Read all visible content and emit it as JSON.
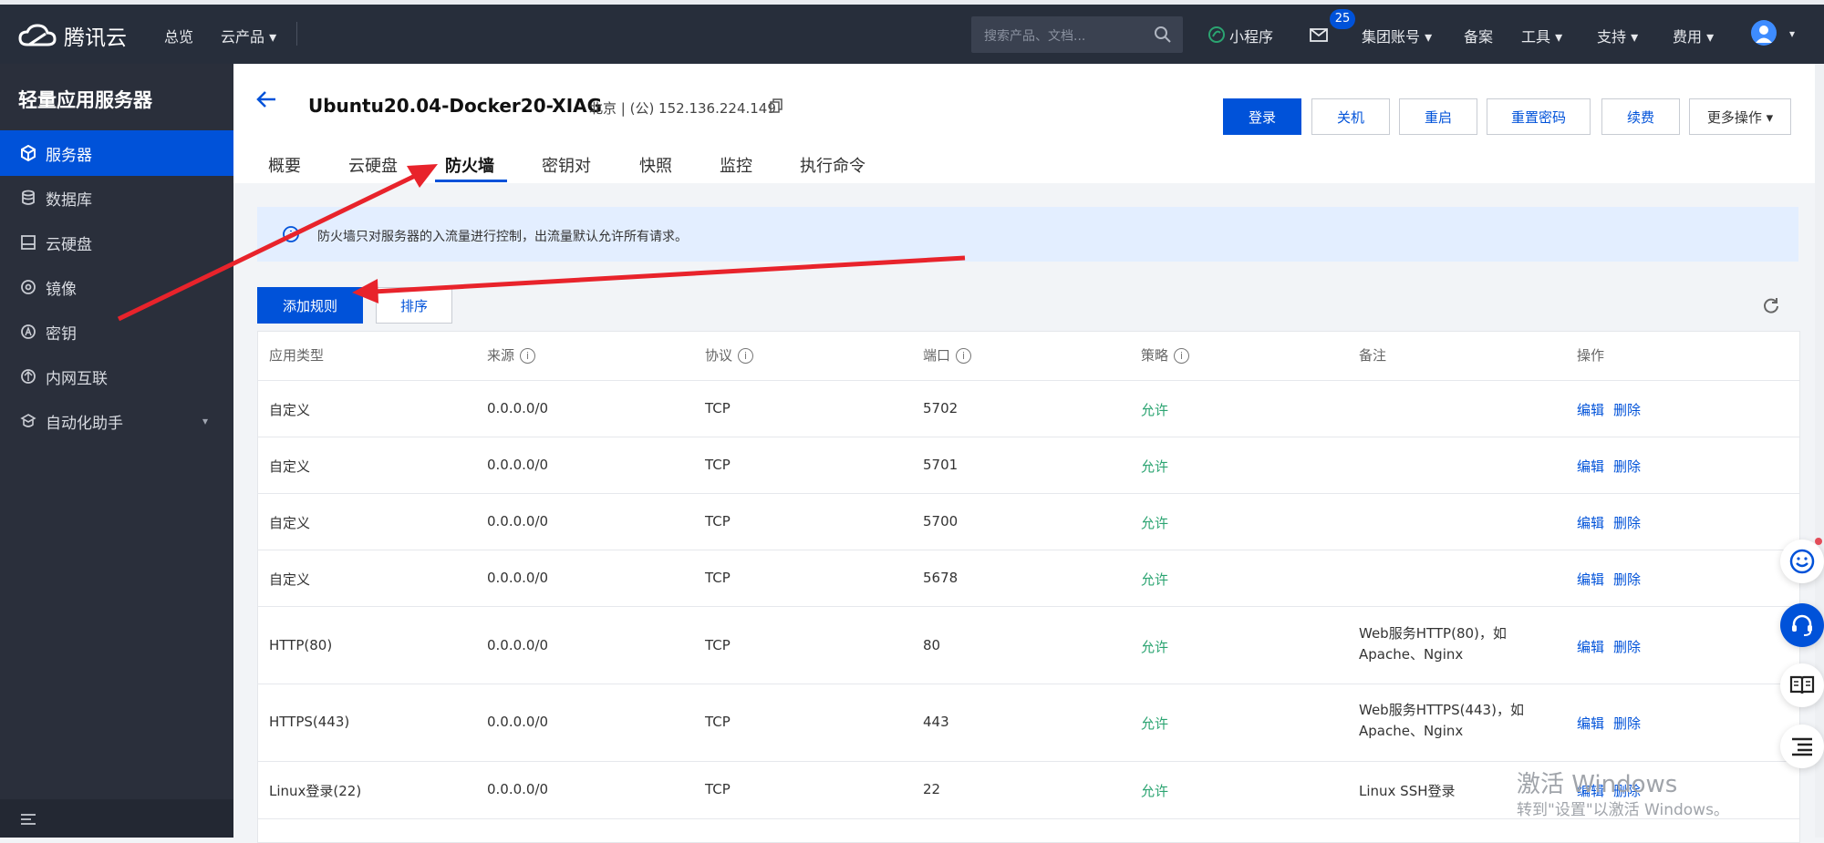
{
  "topbar": {
    "brand": "腾讯云",
    "nav": [
      "总览",
      "云产品 ▾"
    ],
    "search_placeholder": "搜索产品、文档...",
    "mini_program": "小程序",
    "mail_badge": "25",
    "items": [
      "集团账号 ▾",
      "备案",
      "工具 ▾",
      "支持 ▾",
      "费用 ▾"
    ]
  },
  "sidebar": {
    "title": "轻量应用服务器",
    "items": [
      {
        "label": "服务器",
        "icon": "server-icon"
      },
      {
        "label": "数据库",
        "icon": "database-icon"
      },
      {
        "label": "云硬盘",
        "icon": "disk-icon"
      },
      {
        "label": "镜像",
        "icon": "image-icon"
      },
      {
        "label": "密钥",
        "icon": "key-icon"
      },
      {
        "label": "内网互联",
        "icon": "network-icon"
      },
      {
        "label": "自动化助手",
        "icon": "robot-icon"
      }
    ]
  },
  "header": {
    "instance_name": "Ubuntu20.04-Docker20-XIAG",
    "location": "北京 | (公) 152.136.224.149",
    "buttons": [
      "登录",
      "关机",
      "重启",
      "重置密码",
      "续费",
      "更多操作 ▾"
    ],
    "tabs": [
      "概要",
      "云硬盘",
      "防火墙",
      "密钥对",
      "快照",
      "监控",
      "执行命令"
    ]
  },
  "content": {
    "info": "防火墙只对服务器的入流量进行控制，出流量默认允许所有请求。",
    "add_rule": "添加规则",
    "sort": "排序"
  },
  "table": {
    "headers": [
      "应用类型",
      "来源",
      "协议",
      "端口",
      "策略",
      "备注",
      "操作"
    ],
    "edit": "编辑",
    "delete": "删除",
    "rows": [
      {
        "type": "自定义",
        "source": "0.0.0.0/0",
        "protocol": "TCP",
        "port": "5702",
        "policy": "允许",
        "note1": "",
        "note2": ""
      },
      {
        "type": "自定义",
        "source": "0.0.0.0/0",
        "protocol": "TCP",
        "port": "5701",
        "policy": "允许",
        "note1": "",
        "note2": ""
      },
      {
        "type": "自定义",
        "source": "0.0.0.0/0",
        "protocol": "TCP",
        "port": "5700",
        "policy": "允许",
        "note1": "",
        "note2": ""
      },
      {
        "type": "自定义",
        "source": "0.0.0.0/0",
        "protocol": "TCP",
        "port": "5678",
        "policy": "允许",
        "note1": "",
        "note2": ""
      },
      {
        "type": "HTTP(80)",
        "source": "0.0.0.0/0",
        "protocol": "TCP",
        "port": "80",
        "policy": "允许",
        "note1": "Web服务HTTP(80)，如",
        "note2": "Apache、Nginx"
      },
      {
        "type": "HTTPS(443)",
        "source": "0.0.0.0/0",
        "protocol": "TCP",
        "port": "443",
        "policy": "允许",
        "note1": "Web服务HTTPS(443)，如",
        "note2": "Apache、Nginx"
      },
      {
        "type": "Linux登录(22)",
        "source": "0.0.0.0/0",
        "protocol": "TCP",
        "port": "22",
        "policy": "允许",
        "note1": "Linux SSH登录",
        "note2": ""
      }
    ]
  },
  "watermark": {
    "line1": "激活 Windows",
    "line2": "转到\"设置\"以激活 Windows。"
  },
  "colors": {
    "primary": "#0052d9",
    "allow": "#2ba471",
    "annotation": "#e8232b"
  }
}
